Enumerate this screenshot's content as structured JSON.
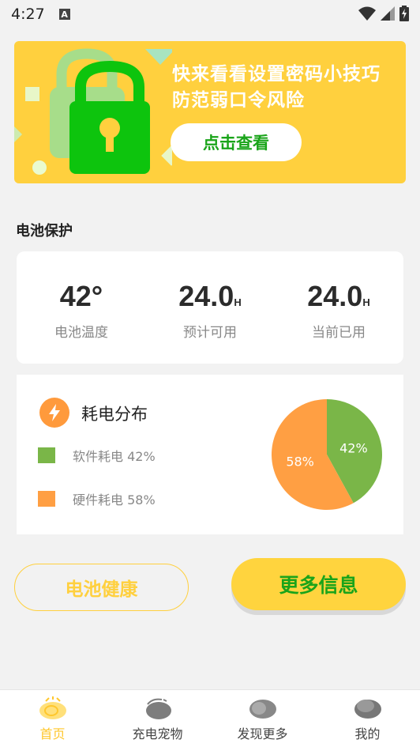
{
  "status_bar": {
    "time": "4:27",
    "notification_letter": "A"
  },
  "banner": {
    "line1": "快来看看设置密码小技巧",
    "line2": "防范弱口令风险",
    "button_label": "点击查看"
  },
  "section_title": "电池保护",
  "stats": [
    {
      "value": "42°",
      "unit": "",
      "label": "电池温度"
    },
    {
      "value": "24.0",
      "unit": "H",
      "label": "预计可用"
    },
    {
      "value": "24.0",
      "unit": "H",
      "label": "当前已用"
    }
  ],
  "distribution": {
    "title": "耗电分布",
    "legend": [
      {
        "label": "软件耗电 42%",
        "color": "#7ab648"
      },
      {
        "label": "硬件耗电 58%",
        "color": "#ff9f43"
      }
    ]
  },
  "chart_data": {
    "type": "pie",
    "categories": [
      "软件耗电",
      "硬件耗电"
    ],
    "values": [
      42,
      58
    ],
    "labels": [
      "42%",
      "58%"
    ],
    "colors": [
      "#7ab648",
      "#ff9f43"
    ]
  },
  "buttons": {
    "health": "电池健康",
    "more": "更多信息"
  },
  "tabs": [
    {
      "label": "首页",
      "active": true
    },
    {
      "label": "充电宠物",
      "active": false
    },
    {
      "label": "发现更多",
      "active": false
    },
    {
      "label": "我的",
      "active": false
    }
  ],
  "colors": {
    "accent_yellow": "#ffd03e",
    "accent_green": "#1aa41a",
    "lock_green": "#0dc40d"
  }
}
